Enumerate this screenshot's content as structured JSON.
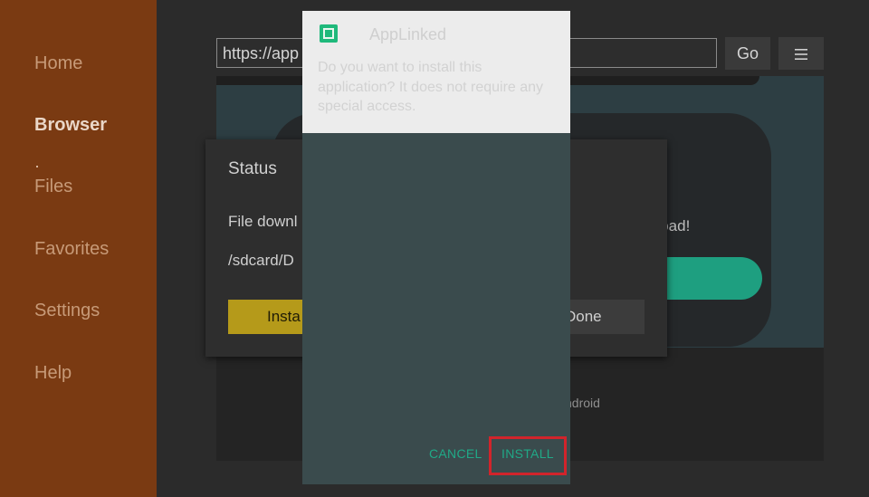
{
  "sidebar": {
    "items": [
      {
        "label": "Home",
        "active": false
      },
      {
        "label": "Browser",
        "active": true
      },
      {
        "label": "Files",
        "active": false
      },
      {
        "label": "Favorites",
        "active": false
      },
      {
        "label": "Settings",
        "active": false
      },
      {
        "label": "Help",
        "active": false
      }
    ]
  },
  "browser": {
    "url": "https://app",
    "go_label": "Go",
    "menu_icon": "menu-icon",
    "page_text_download": "nload!",
    "page_text_android": "ndroid"
  },
  "status_dialog": {
    "title": "Status",
    "line1": "File downl",
    "line2": "/sdcard/D",
    "install_label": "Insta",
    "done_label": "Done"
  },
  "installer": {
    "app_icon": "applinked-app-icon",
    "app_name": "AppLinked",
    "question": "Do you want to install this application? It does not require any special access.",
    "cancel_label": "CANCEL",
    "install_label": "INSTALL"
  },
  "colors": {
    "sidebar": "#7a3a12",
    "accent_green": "#20a987",
    "highlight": "#d1242b",
    "install_yellow": "#b59a1a"
  }
}
